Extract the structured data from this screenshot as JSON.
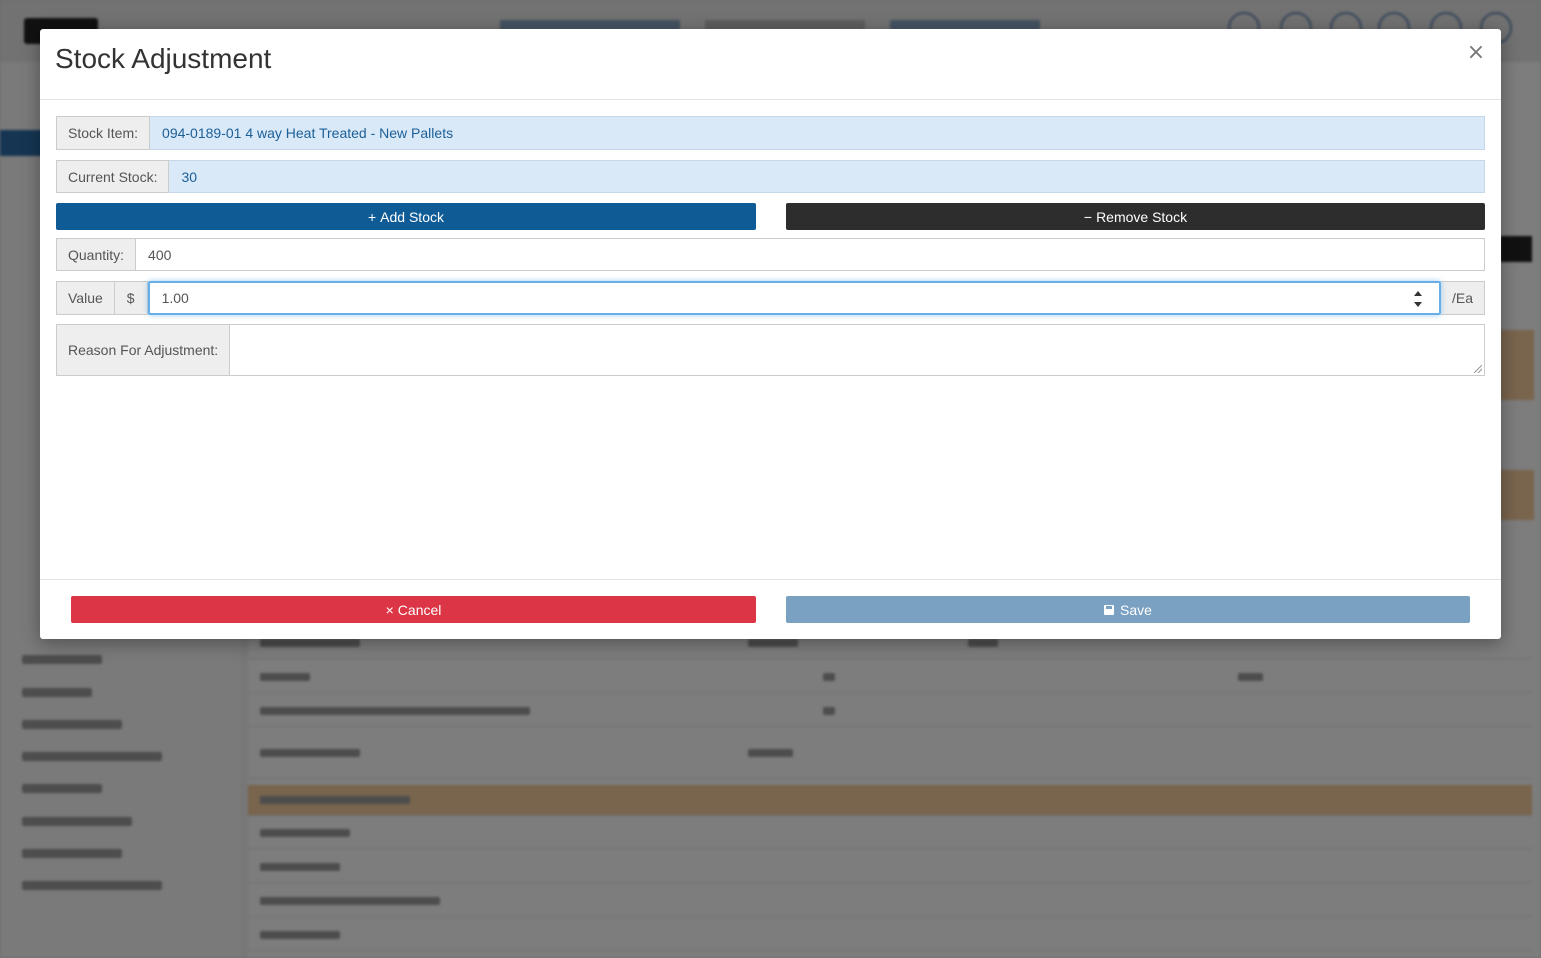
{
  "modal": {
    "title": "Stock Adjustment",
    "close_glyph": "×",
    "stock_item": {
      "label": "Stock Item:",
      "value": "094-0189-01 4 way Heat Treated - New Pallets"
    },
    "current_stock": {
      "label": "Current Stock:",
      "value": "30"
    },
    "add_stock_button": {
      "icon": "plus-icon",
      "glyph": "+",
      "label": "Add Stock"
    },
    "remove_stock_button": {
      "icon": "minus-icon",
      "glyph": "−",
      "label": "Remove Stock"
    },
    "quantity": {
      "label": "Quantity:",
      "value": "400"
    },
    "value": {
      "label": "Value",
      "currency": "$",
      "amount": "1.00",
      "unit": "/Ea"
    },
    "reason": {
      "label": "Reason For Adjustment:",
      "value": ""
    },
    "cancel_button": {
      "icon": "close-icon",
      "glyph": "×",
      "label": "Cancel"
    },
    "save_button": {
      "icon": "floppy-disk-icon",
      "label": "Save"
    }
  },
  "colors": {
    "add_stock": "#0f5b96",
    "remove_stock": "#2d2d2d",
    "cancel": "#dc3545",
    "save": "#7aa0c2",
    "info_field": "#d9e9f8"
  }
}
